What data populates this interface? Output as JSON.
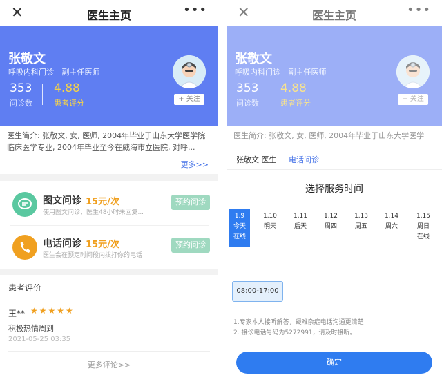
{
  "left": {
    "nav": {
      "close": "✕",
      "title": "医生主页",
      "more": "•••"
    },
    "doctor": {
      "name": "张敬文",
      "department": "呼吸内科门诊",
      "position": "副主任医师",
      "consult_count": "353",
      "consult_label": "问诊数",
      "rating": "4.88",
      "rating_label": "患者评分",
      "follow": "+ 关注"
    },
    "intro": {
      "text": "医生简介: 张敬文, 女, 医师, 2004年毕业于山东大学医学院临床医学专业, 2004年毕业至今在威海市立医院, 对呼...",
      "more": "更多>>"
    },
    "services": [
      {
        "name": "图文问诊",
        "price": "15元/次",
        "desc": "使用图文问诊，医生48小时未回复...",
        "button": "预约问诊",
        "icon": "chat-icon",
        "color": "#5ac8a0"
      },
      {
        "name": "电话问诊",
        "price": "15元/次",
        "desc": "医生会在预定时间段内拨打你的电话",
        "button": "预约问诊",
        "icon": "phone-icon",
        "color": "#f0a020"
      }
    ],
    "reviews": {
      "header": "患者评价",
      "user": "王**",
      "stars": "★★★★★",
      "text": "积极热情周到",
      "time": "2021-05-25 03:35",
      "more": "更多评论>>"
    }
  },
  "right": {
    "nav": {
      "close": "✕",
      "title": "医生主页",
      "more": "•••"
    },
    "doctor": {
      "name": "张敬文",
      "department": "呼吸内科门诊",
      "position": "副主任医师",
      "consult_count": "353",
      "consult_label": "问诊数",
      "rating": "4.88",
      "rating_label": "患者评分",
      "follow": "+ 关注"
    },
    "intro_text": "医生简介: 张敬文, 女, 医师, 2004年毕业于山东大学医学",
    "sheet": {
      "tab_doctor": "张敬文 医生",
      "tab_phone": "电话问诊",
      "title": "选择服务时间",
      "days": [
        {
          "date": "1.9",
          "label": "今天",
          "status": "在线",
          "selected": true
        },
        {
          "date": "1.10",
          "label": "明天",
          "status": ""
        },
        {
          "date": "1.11",
          "label": "后天",
          "status": ""
        },
        {
          "date": "1.12",
          "label": "周四",
          "status": ""
        },
        {
          "date": "1.13",
          "label": "周五",
          "status": ""
        },
        {
          "date": "1.14",
          "label": "周六",
          "status": ""
        },
        {
          "date": "1.15",
          "label": "周日",
          "status": "在线"
        }
      ],
      "time_slot": "08:00-17:00",
      "note1": "1.专家本人接听解答，疑难杂症电话沟通更清楚",
      "note2": "2. 接诊电话号码为5272991，请及时接听。",
      "confirm": "确定"
    }
  },
  "colors": {
    "accent": "#5f7ef2",
    "primary_blue": "#2f7cf0",
    "price": "#f0a020",
    "book_button": "#9fd9c0"
  }
}
